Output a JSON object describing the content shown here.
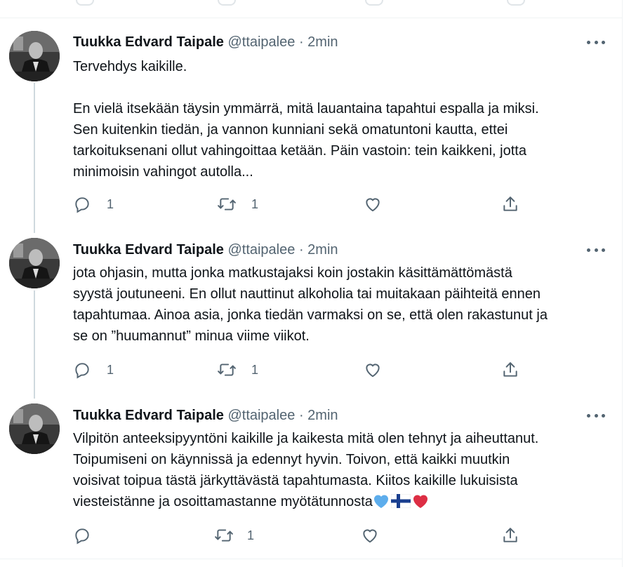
{
  "colors": {
    "text": "#0f1419",
    "secondary": "#536471",
    "divider": "#eff3f4",
    "thread_line": "#cfd9de"
  },
  "tweets": [
    {
      "author_name": "Tuukka Edvard Taipale",
      "handle": "@ttaipalee",
      "separator": "·",
      "time": "2min",
      "text": "Tervehdys kaikille.\n\nEn vielä itsekään täysin ymmärrä, mitä lauantaina tapahtui espalla ja miksi.\nSen kuitenkin tiedän, ja vannon kunniani sekä omatuntoni kautta, ettei\ntarkoituksenani ollut vahingoittaa ketään. Päin vastoin: tein kaikkeni, jotta\nminimoisin vahingot autolla...",
      "reply_count": "1",
      "retweet_count": "1",
      "like_count": "",
      "icons": [
        "reply-icon",
        "retweet-icon",
        "like-icon",
        "share-icon"
      ]
    },
    {
      "author_name": "Tuukka Edvard Taipale",
      "handle": "@ttaipalee",
      "separator": "·",
      "time": "2min",
      "text": "jota ohjasin, mutta jonka matkustajaksi koin jostakin käsittämättömästä\nsyystä joutuneeni. En ollut nauttinut alkoholia tai muitakaan päihteitä ennen\ntapahtumaa. Ainoa asia, jonka tiedän varmaksi on se, että olen rakastunut ja\nse on ”huumannut” minua viime viikot.",
      "reply_count": "1",
      "retweet_count": "1",
      "like_count": "",
      "icons": [
        "reply-icon",
        "retweet-icon",
        "like-icon",
        "share-icon"
      ]
    },
    {
      "author_name": "Tuukka Edvard Taipale",
      "handle": "@ttaipalee",
      "separator": "·",
      "time": "2min",
      "text": "Vilpitön anteeksipyyntöni kaikille ja kaikesta mitä olen tehnyt ja aiheuttanut.\nToipumiseni on käynnissä ja edennyt hyvin. Toivon, että kaikki muutkin\nvoisivat toipua tästä järkyttävästä tapahtumasta. Kiitos kaikille lukuisista\nviesteistänne ja osoittamastanne myötätunnosta",
      "emojis": [
        "blue-heart-emoji",
        "finland-flag-emoji",
        "red-heart-emoji"
      ],
      "reply_count": "",
      "retweet_count": "1",
      "like_count": "",
      "icons": [
        "reply-icon",
        "retweet-icon",
        "like-icon",
        "share-icon"
      ]
    }
  ]
}
